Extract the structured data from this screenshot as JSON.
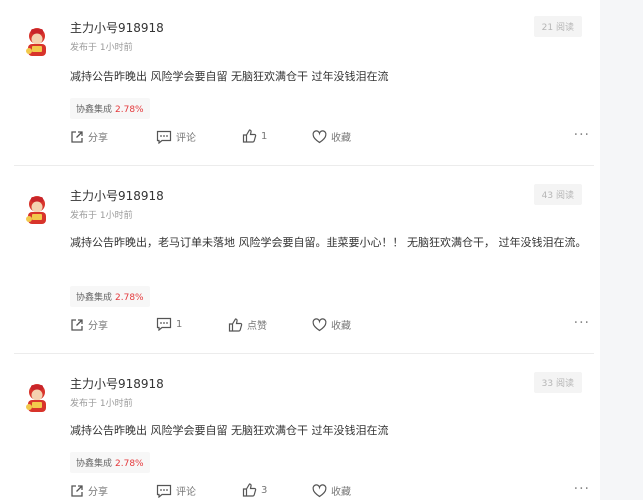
{
  "posts": [
    {
      "username": "主力小号918918",
      "time": "发布于 1小时前",
      "views": "21 阅读",
      "content": "减持公告昨晚出 风险学会要自留 无脑狂欢满仓干 过年没钱泪在流",
      "stock_name": "协鑫集成",
      "stock_change": "2.78%",
      "share_label": "分享",
      "comment_label": "评论",
      "like_label": "1",
      "collect_label": "收藏"
    },
    {
      "username": "主力小号918918",
      "time": "发布于 1小时前",
      "views": "43 阅读",
      "content": "减持公告昨晚出，老马订单未落地 风险学会要自留。韭菜要小心！！ 无脑狂欢满仓干， 过年没钱泪在流。",
      "stock_name": "协鑫集成",
      "stock_change": "2.78%",
      "share_label": "分享",
      "comment_label": "1",
      "like_label": "点赞",
      "collect_label": "收藏"
    },
    {
      "username": "主力小号918918",
      "time": "发布于 1小时前",
      "views": "33 阅读",
      "content": "减持公告昨晚出 风险学会要自留 无脑狂欢满仓干 过年没钱泪在流",
      "stock_name": "协鑫集成",
      "stock_change": "2.78%",
      "share_label": "分享",
      "comment_label": "评论",
      "like_label": "3",
      "collect_label": "收藏"
    }
  ],
  "more_label": "···",
  "icons": {
    "share": "share-icon",
    "comment": "comment-icon",
    "like": "thumbs-up-icon",
    "collect": "heart-icon",
    "avatar": "caishen-avatar"
  },
  "colors": {
    "price_up": "#e4393c",
    "muted": "#9a9a9a",
    "gutter": "#f5f6f8"
  }
}
